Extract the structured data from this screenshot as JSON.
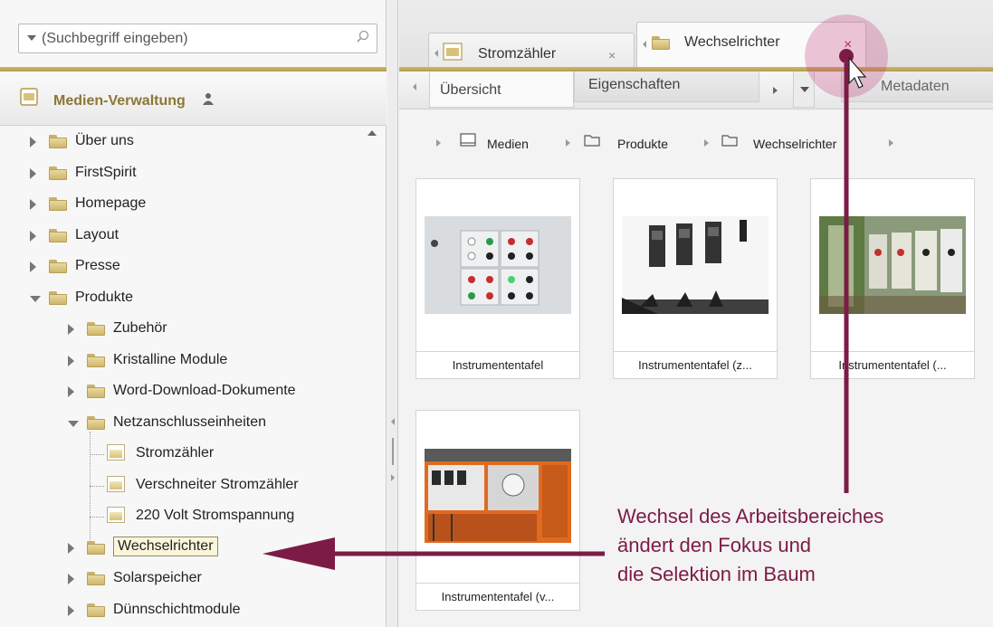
{
  "search": {
    "placeholder": "(Suchbegriff eingeben)"
  },
  "left_header": {
    "title": "Medien-Verwaltung"
  },
  "tree": [
    {
      "label": "Über uns",
      "level": 0,
      "state": "collapsed",
      "icon": "folder-icon"
    },
    {
      "label": "FirstSpirit",
      "level": 0,
      "state": "collapsed",
      "icon": "folder-icon"
    },
    {
      "label": "Homepage",
      "level": 0,
      "state": "collapsed",
      "icon": "folder-icon"
    },
    {
      "label": "Layout",
      "level": 0,
      "state": "collapsed",
      "icon": "folder-icon"
    },
    {
      "label": "Presse",
      "level": 0,
      "state": "collapsed",
      "icon": "folder-icon"
    },
    {
      "label": "Produkte",
      "level": 0,
      "state": "expanded",
      "icon": "folder-icon"
    },
    {
      "label": "Zubehör",
      "level": 1,
      "state": "collapsed",
      "icon": "folder-icon"
    },
    {
      "label": "Kristalline Module",
      "level": 1,
      "state": "collapsed",
      "icon": "folder-icon"
    },
    {
      "label": "Word-Download-Dokumente",
      "level": 1,
      "state": "collapsed",
      "icon": "folder-icon"
    },
    {
      "label": "Netzanschlusseinheiten",
      "level": 1,
      "state": "expanded",
      "icon": "folder-icon"
    },
    {
      "label": "Stromzähler",
      "level": 2,
      "state": "leaf",
      "icon": "image-icon"
    },
    {
      "label": "Verschneiter Stromzähler",
      "level": 2,
      "state": "leaf",
      "icon": "image-icon"
    },
    {
      "label": "220 Volt Stromspannung",
      "level": 2,
      "state": "leaf",
      "icon": "image-icon"
    },
    {
      "label": "Wechselrichter",
      "level": 1,
      "state": "collapsed",
      "icon": "folder-icon",
      "selected": true
    },
    {
      "label": "Solarspeicher",
      "level": 1,
      "state": "collapsed",
      "icon": "folder-icon"
    },
    {
      "label": "Dünnschichtmodule",
      "level": 1,
      "state": "collapsed",
      "icon": "folder-icon"
    }
  ],
  "workspace_tabs": [
    {
      "label": "Stromzähler",
      "close": "×",
      "icon": "image-icon"
    },
    {
      "label": "Wechselrichter",
      "close": "×",
      "icon": "folder-icon",
      "active": true
    }
  ],
  "view_tabs": [
    {
      "label": "Übersicht"
    },
    {
      "label": "Eigenschaften"
    },
    {
      "label": "Metadaten"
    }
  ],
  "breadcrumb": [
    {
      "label": "Medien",
      "icon": "media-icon"
    },
    {
      "label": "Produkte",
      "icon": "folder-outline-icon"
    },
    {
      "label": "Wechselrichter",
      "icon": "folder-outline-icon"
    }
  ],
  "media_items": [
    {
      "caption": "Instrumententafel"
    },
    {
      "caption": "Instrumententafel (z..."
    },
    {
      "caption": "Instrumententafel (..."
    },
    {
      "caption": "Instrumententafel (v..."
    }
  ],
  "annotation": {
    "lines": [
      "Wechsel des Arbeitsbereiches",
      "ändert den Fokus und",
      "die Selektion im Baum"
    ],
    "color": "#7c1b45"
  },
  "colors": {
    "accent_gold": "#c4a85a",
    "header_text": "#8d7635",
    "annotation": "#7c1b45"
  }
}
